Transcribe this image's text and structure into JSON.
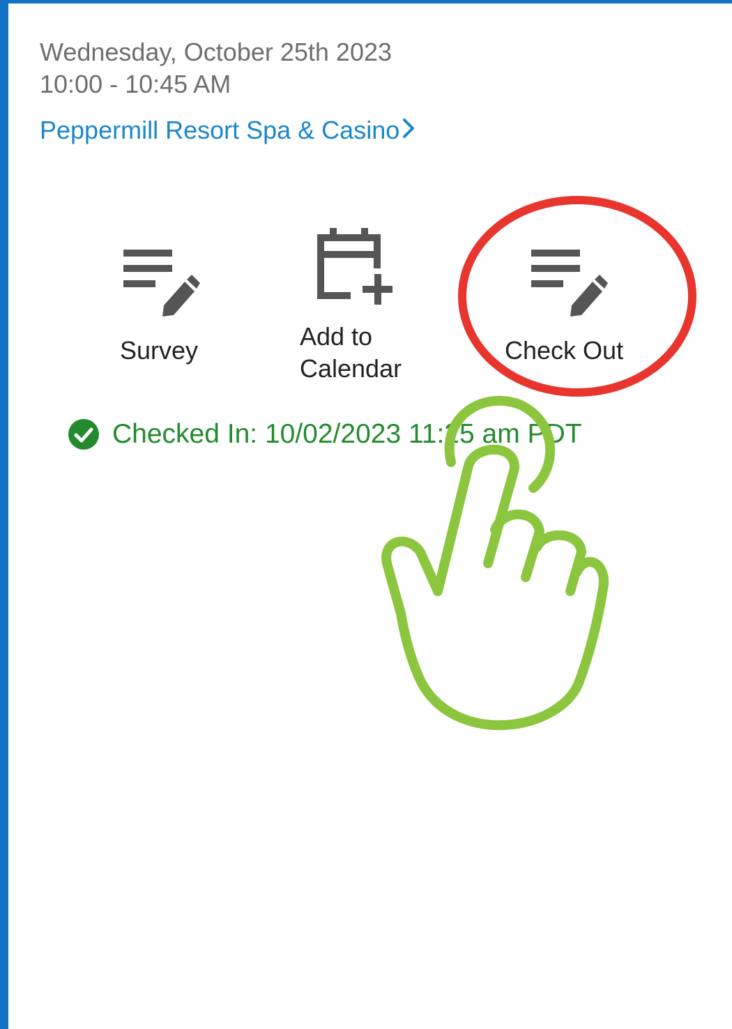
{
  "event": {
    "date": "Wednesday, October 25th 2023",
    "time": "10:00 - 10:45 AM",
    "location": "Peppermill Resort Spa & Casino"
  },
  "actions": [
    {
      "label": "Survey",
      "icon": "survey-icon"
    },
    {
      "label_line1": "Add to",
      "label_line2": "Calendar",
      "icon": "calendar-add-icon"
    },
    {
      "label": "Check Out",
      "icon": "checkout-icon"
    }
  ],
  "status": {
    "checked_in": "Checked In: 10/02/2023 11:25 am PDT",
    "icon": "check-circle-icon"
  },
  "colors": {
    "frame": "#1472c4",
    "link": "#1a86cc",
    "success": "#238b2d",
    "highlight": "#e8352e",
    "pointer": "#8cc63f"
  }
}
